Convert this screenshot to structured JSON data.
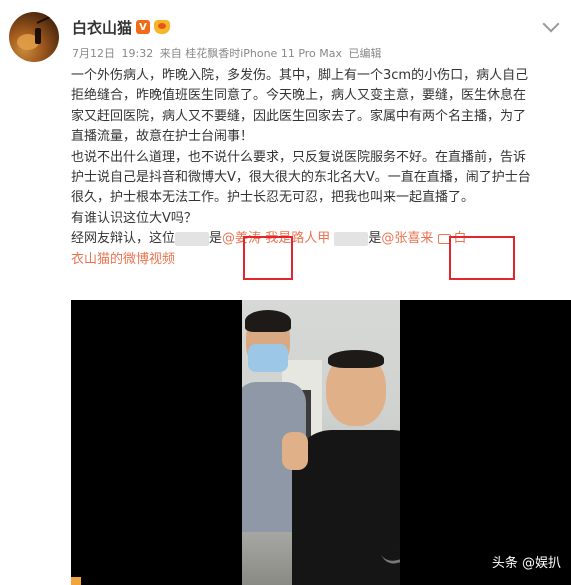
{
  "post": {
    "user_name": "白衣山猫",
    "vip_badge": "V",
    "meta": {
      "date": "7月12日",
      "time": "19:32",
      "source": "来自 桂花飘香时iPhone 11 Pro Max",
      "edited": "已编辑"
    },
    "content": {
      "line1": "一个外伤病人，昨晚入院，多发伤。其中，脚上有一个3cm的小伤口，病人自己",
      "line2": "拒绝缝合，昨晚值班医生同意了。今天晚上，病人又变主意，要缝，医生休息在",
      "line3": "家又赶回医院，病人又不要缝，因此医生回家去了。家属中有两个名主播，为了",
      "line4": "直播流量，故意在护士台闹事！",
      "line5": "也说不出什么道理，也不说什么要求，只反复说医院服务不好。在直播前，告诉",
      "line6": "护士说自己是抖音和微博大V，很大很大的东北名大V。一直在直播，闹了护士台",
      "line7": "很久，护士根本无法工作。护士长忍无可忍，把我也叫来一起直播了。",
      "line8": "有谁认识这位大V吗？",
      "line9_prefix": "经网友辩认，这位",
      "line9_mid1": "是",
      "mention1": "@姜涛",
      "mention2": "我是路人甲",
      "line9_mid2": "是",
      "mention3": "@张喜来",
      "video_link_part1": "白",
      "video_link_part2": "衣山猫的微博视频"
    },
    "video": {
      "watermark": "头条 @娱扒"
    },
    "colors": {
      "link": "#eb7350",
      "highlight_box": "#e3262b",
      "vip": "#f36a16"
    }
  }
}
